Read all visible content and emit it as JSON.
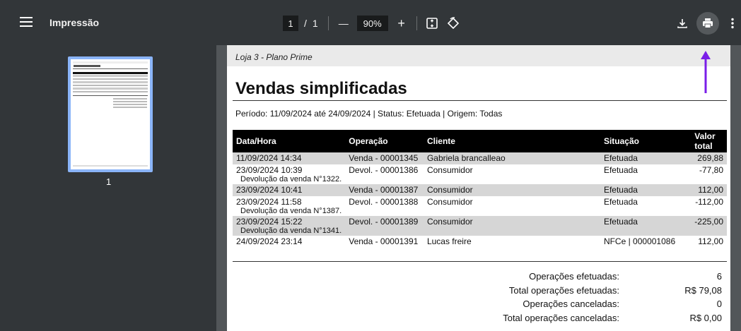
{
  "toolbar": {
    "title": "Impressão",
    "page_current": "1",
    "page_separator": "/",
    "page_total": "1",
    "zoom_value": "90%",
    "zoom_out_label": "—",
    "zoom_in_label": "+"
  },
  "sidebar": {
    "thumbnail_page_number": "1"
  },
  "document": {
    "store": "Loja 3 - Plano Prime",
    "title": "Vendas simplificadas",
    "filters": "Período: 11/09/2024 até 24/09/2024 | Status: Efetuada | Origem: Todas",
    "columns": [
      "Data/Hora",
      "Operação",
      "Cliente",
      "Situação",
      "Valor total"
    ],
    "rows": [
      {
        "datetime": "11/09/2024 14:34",
        "operation": "Venda - 00001345",
        "client": "Gabriela brancalleao",
        "status": "Efetuada",
        "value": "269,88",
        "note": ""
      },
      {
        "datetime": "23/09/2024 10:39",
        "operation": "Devol. - 00001386",
        "client": "Consumidor",
        "status": "Efetuada",
        "value": "-77,80",
        "note": "Devolução da venda N°1322."
      },
      {
        "datetime": "23/09/2024 10:41",
        "operation": "Venda - 00001387",
        "client": "Consumidor",
        "status": "Efetuada",
        "value": "112,00",
        "note": ""
      },
      {
        "datetime": "23/09/2024 11:58",
        "operation": "Devol. - 00001388",
        "client": "Consumidor",
        "status": "Efetuada",
        "value": "-112,00",
        "note": "Devolução da venda N°1387."
      },
      {
        "datetime": "23/09/2024 15:22",
        "operation": "Devol. - 00001389",
        "client": "Consumidor",
        "status": "Efetuada",
        "value": "-225,00",
        "note": "Devolução da venda N°1341."
      },
      {
        "datetime": "24/09/2024 23:14",
        "operation": "Venda - 00001391",
        "client": "Lucas freire",
        "status": "NFCe | 000001086",
        "value": "112,00",
        "note": ""
      }
    ],
    "totals": [
      {
        "label": "Operações efetuadas:",
        "value": "6"
      },
      {
        "label": "Total operações efetuadas:",
        "value": "R$ 79,08"
      },
      {
        "label": "Operações canceladas:",
        "value": "0"
      },
      {
        "label": "Total operações canceladas:",
        "value": "R$ 0,00"
      }
    ]
  },
  "colors": {
    "toolbar_bg": "#323639",
    "viewer_bg": "#525659",
    "arrow": "#7a1ee8",
    "thumb_border": "#8ab4f8"
  },
  "icons": [
    "menu-icon",
    "fit-page-icon",
    "rotate-icon",
    "download-icon",
    "print-icon",
    "more-vert-icon"
  ]
}
